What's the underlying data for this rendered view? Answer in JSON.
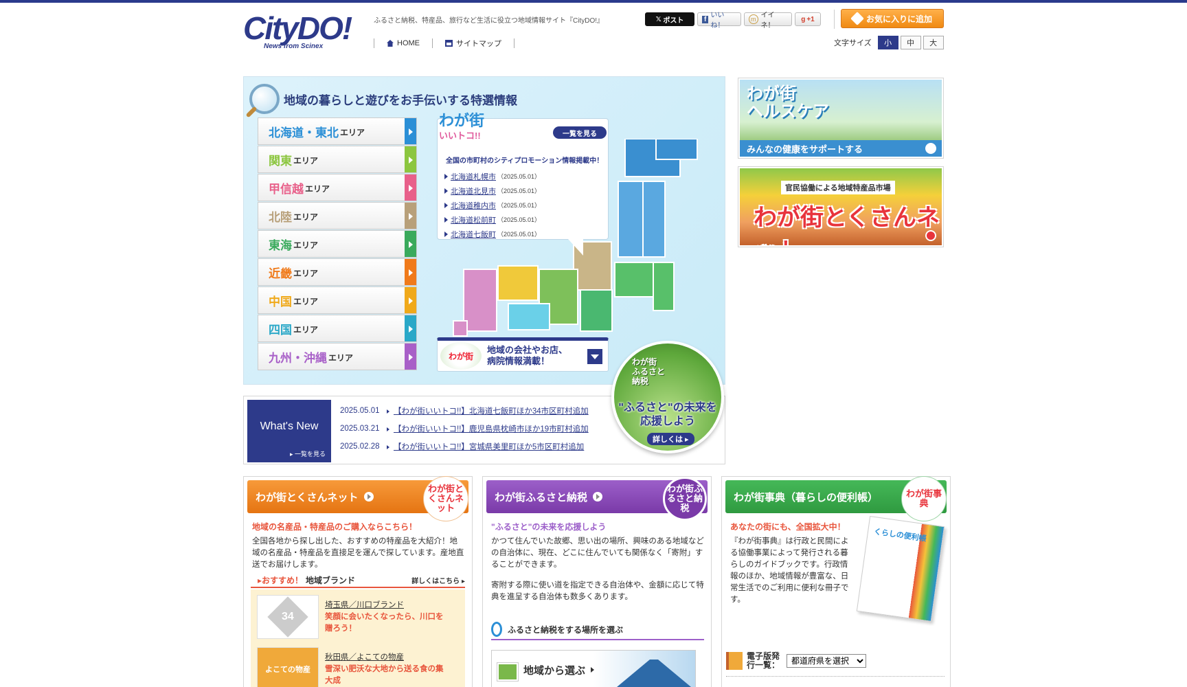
{
  "header": {
    "logo": "CityDO!",
    "logo_sub": "News from Scinex",
    "tagline": "ふるさと納税、特産品、旅行など生活に役立つ地域情報サイト『CityDO!』",
    "nav": [
      {
        "label": "HOME",
        "icon": "home-icon"
      },
      {
        "label": "サイトマップ",
        "icon": "sitemap-icon"
      }
    ],
    "social": {
      "x": "ポスト",
      "facebook": "いいね！",
      "mixi": "イイネ！",
      "google": "+1"
    },
    "favorite_label": "お気に入りに追加",
    "font_size": {
      "label": "文字サイズ",
      "options": [
        "小",
        "中",
        "大"
      ],
      "selected": "小"
    }
  },
  "feature": {
    "title": "地域の暮らしと遊びをお手伝いする特選情報",
    "areas": [
      {
        "name": "北海道・東北",
        "suffix": "エリア",
        "color": "#2b8fd6"
      },
      {
        "name": "関東",
        "suffix": "エリア",
        "color": "#8cc63f"
      },
      {
        "name": "甲信越",
        "suffix": "エリア",
        "color": "#e8608a"
      },
      {
        "name": "北陸",
        "suffix": "エリア",
        "color": "#b8a07a"
      },
      {
        "name": "東海",
        "suffix": "エリア",
        "color": "#3aaa5c"
      },
      {
        "name": "近畿",
        "suffix": "エリア",
        "color": "#f07a1a"
      },
      {
        "name": "中国",
        "suffix": "エリア",
        "color": "#f0a91a"
      },
      {
        "name": "四国",
        "suffix": "エリア",
        "color": "#2aa8c8"
      },
      {
        "name": "九州・沖縄",
        "suffix": "エリア",
        "color": "#a860c8"
      }
    ],
    "itoko": {
      "logo_top": "わが街",
      "logo_bottom": "いいトコ!!",
      "more_label": "一覧を見る",
      "lead": "全国の市町村のシティプロモーション情報掲載中！",
      "items": [
        {
          "city": "北海道札幌市",
          "date": "（2025.05.01）"
        },
        {
          "city": "北海道北見市",
          "date": "（2025.05.01）"
        },
        {
          "city": "北海道稚内市",
          "date": "（2025.05.01）"
        },
        {
          "city": "北海道松前町",
          "date": "（2025.05.01）"
        },
        {
          "city": "北海道七飯町",
          "date": "（2025.05.01）"
        }
      ]
    },
    "gyoshu": {
      "logo": "わが街",
      "text_line1": "地域の会社やお店、",
      "text_line2": "病院情報満載！"
    }
  },
  "whats_new": {
    "title": "What's New",
    "more_label": "一覧を見る",
    "items": [
      {
        "date": "2025.05.01",
        "text": "【わが街いいトコ!!】北海道七飯町ほか34市区町村追加"
      },
      {
        "date": "2025.03.21",
        "text": "【わが街いいトコ!!】鹿児島県枕崎市ほか19市町村追加"
      },
      {
        "date": "2025.02.28",
        "text": "【わが街いいトコ!!】宮城県美里町ほか5市区町村追加"
      }
    ]
  },
  "furusato_badge": {
    "logo_line1": "わが街",
    "logo_line2": "ふるさと",
    "logo_line3": "納税",
    "copy_line1": "\"ふるさと\"の未来を",
    "copy_line2": "応援しよう",
    "more_label": "詳しくは"
  },
  "banners": {
    "healthcare": {
      "title_line1": "わが街",
      "title_line2": "ヘルスケア",
      "bar": "みんなの健康をサポートする"
    },
    "tokusan": {
      "sub": "官民協働による地域特産品市場",
      "title": "わが街とくさんネット"
    }
  },
  "columns": {
    "tokusan": {
      "head": "わが街とくさんネット",
      "badge": "わが街とくさんネット",
      "lead": "地域の名産品・特産品のご購入ならこちら！",
      "body": "全国各地から探し出した、おすすめの特産品を大紹介！地域の名産品・特産品を直接足を運んで探しています。産地直送でお届けします。",
      "brand_head_rec": "おすすめ！",
      "brand_head_sub": "地域ブランド",
      "brand_more": "詳しくはこちら",
      "brands": [
        {
          "thumb": "34",
          "name": "埼玉県／川口ブランド",
          "desc": "笑顔に会いたくなったら、川口を贈ろう！"
        },
        {
          "thumb": "よこての物産",
          "name": "秋田県／よこての物産",
          "desc": "雪深い肥沃な大地から送る食の集大成"
        }
      ]
    },
    "furusato": {
      "head": "わが街ふるさと納税",
      "badge": "わが街ふるさと納税",
      "lead": "\"ふるさと\"の未来を応援しよう",
      "body": "かつて住んでいた故郷、思い出の場所、興味のある地域などの自治体に、現在、どこに住んでいても関係なく「寄附」することができます。",
      "body2": "寄附する際に使い道を指定できる自治体や、金額に応じて特典を進呈する自治体も数多くあります。",
      "select_head": "ふるさと納税をする場所を選ぶ",
      "region_btn": "地域から選ぶ"
    },
    "jiten": {
      "head": "わが街事典（暮らしの便利帳）",
      "badge": "わが街事典",
      "lead": "あなたの街にも、全国拡大中！",
      "body": "『わが街事典』は行政と民間による協働事業によって発行される暮らしのガイドブックです。行政情報のほか、地域情報が豊富な、日常生活でのご利用に便利な冊子です。",
      "book_label": "くらしの便利帳",
      "ebook_label": "電子版発行一覧：",
      "select_value": "都道府県を選択"
    }
  }
}
